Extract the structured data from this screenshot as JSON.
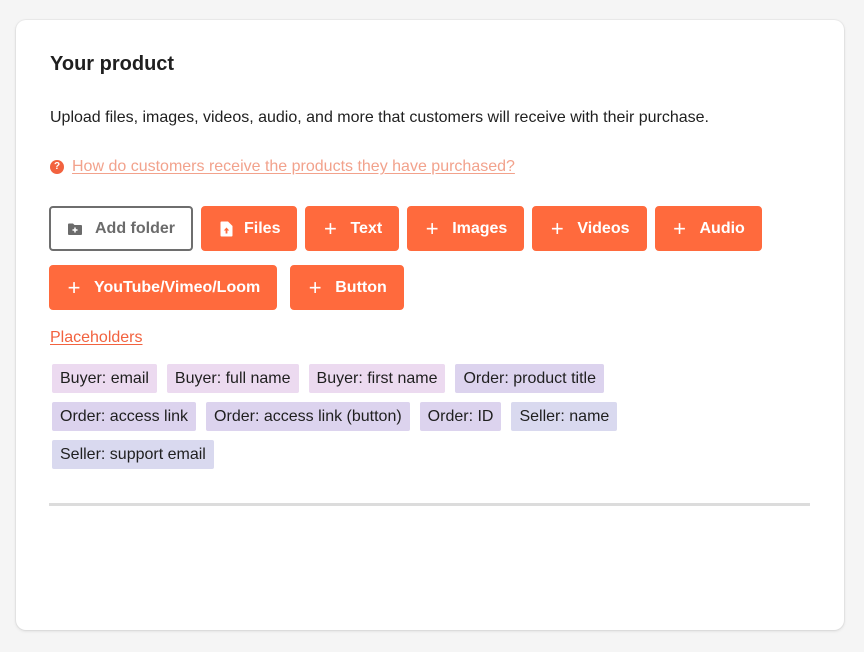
{
  "section": {
    "title": "Your product",
    "description": "Upload files, images, videos, audio, and more that customers will receive with their purchase.",
    "help_link": "How do customers receive the products they have purchased?"
  },
  "buttons": {
    "add_folder": "Add folder",
    "files": "Files",
    "text": "Text",
    "images": "Images",
    "videos": "Videos",
    "audio": "Audio",
    "embed": "YouTube/Vimeo/Loom",
    "button": "Button"
  },
  "placeholders": {
    "link_label": "Placeholders",
    "tags": [
      "Buyer: email",
      "Buyer: full name",
      "Buyer: first name",
      "Order: product title",
      "Order: access link",
      "Order: access link (button)",
      "Order: ID",
      "Seller: name",
      "Seller: support email"
    ]
  },
  "icons": {
    "help": "question-circle-icon",
    "add_folder": "folder-plus-icon",
    "files": "file-upload-icon",
    "add": "plus-icon"
  },
  "colors": {
    "accent": "#ff6a3d",
    "help_link": "#f2a28c",
    "tag_buyer": "#ecdaf0",
    "tag_order": "#dcd3ee",
    "tag_seller": "#d9d9ef"
  }
}
